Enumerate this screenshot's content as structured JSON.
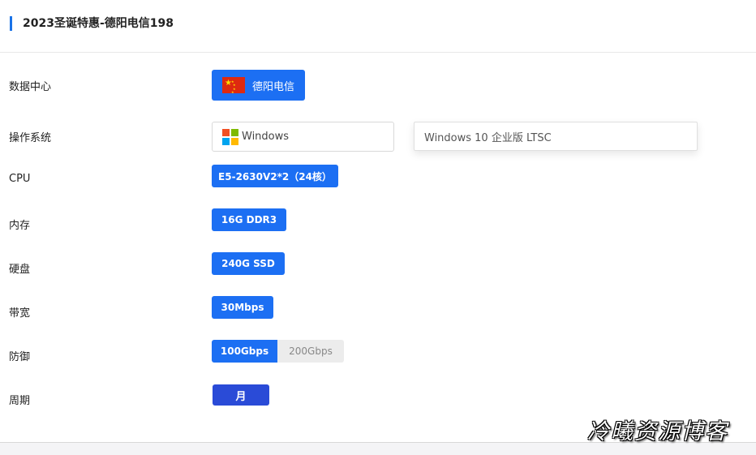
{
  "header": {
    "title": "2023圣诞特惠-德阳电信198",
    "accent_color": "#1a73e8"
  },
  "labels": {
    "datacenter": "数据中心",
    "os": "操作系统",
    "cpu": "CPU",
    "memory": "内存",
    "disk": "硬盘",
    "bandwidth": "带宽",
    "ddos": "防御",
    "cycle": "周期"
  },
  "datacenter": {
    "name": "德阳电信",
    "flag_icon": "china-flag-icon"
  },
  "os": {
    "family": "Windows",
    "family_icon": "windows-logo-icon",
    "version": "Windows 10 企业版 LTSC"
  },
  "options": {
    "cpu": "E5-2630V2*2（24核）",
    "memory": "16G DDR3",
    "disk": "240G SSD",
    "bandwidth": "30Mbps",
    "ddos": [
      {
        "label": "100Gbps",
        "selected": true
      },
      {
        "label": "200Gbps",
        "selected": false
      }
    ],
    "cycle": "月"
  },
  "colors": {
    "primary": "#1c6ff3",
    "cycle_button": "#2a4bd7",
    "unselected": "#ececec"
  },
  "watermark": "冷曦资源博客"
}
